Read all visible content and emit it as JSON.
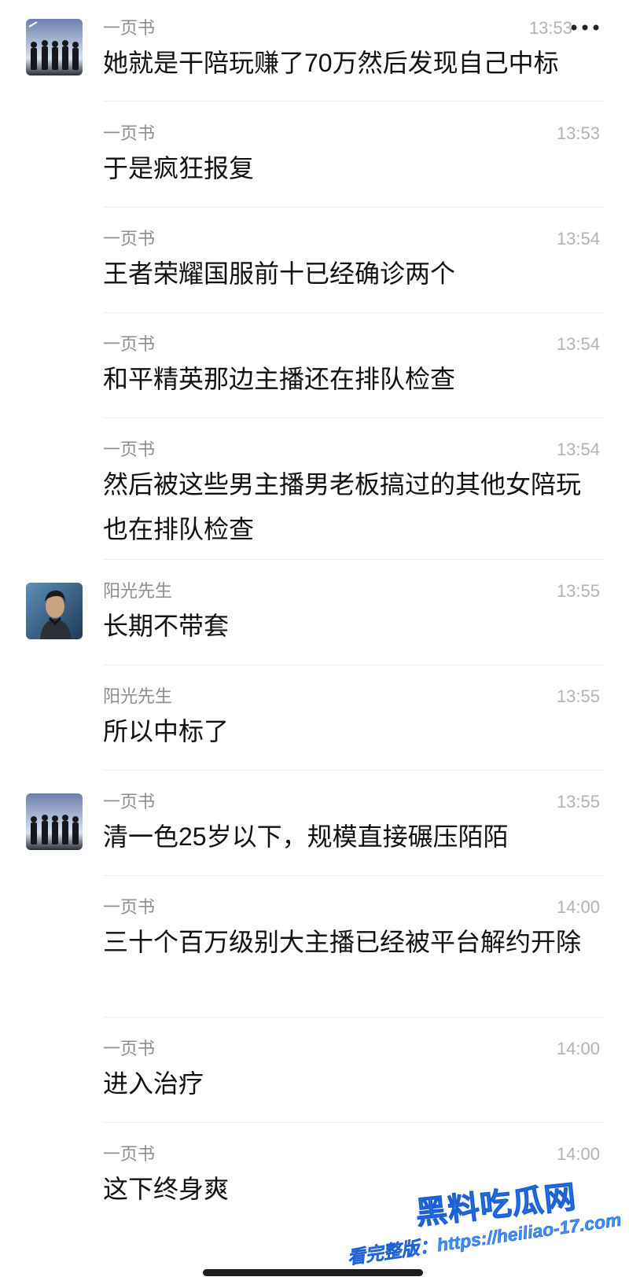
{
  "messages": [
    {
      "sender": "一页书",
      "time": "13:53",
      "text": "她就是干陪玩赚了70万然后发现自己中标",
      "avatar": "group-silhouette"
    },
    {
      "sender": "一页书",
      "time": "13:53",
      "text": "于是疯狂报复"
    },
    {
      "sender": "一页书",
      "time": "13:54",
      "text": "王者荣耀国服前十已经确诊两个"
    },
    {
      "sender": "一页书",
      "time": "13:54",
      "text": "和平精英那边主播还在排队检查"
    },
    {
      "sender": "一页书",
      "time": "13:54",
      "text": "然后被这些男主播男老板搞过的其他女陪玩也在排队检查"
    },
    {
      "sender": "阳光先生",
      "time": "13:55",
      "text": "长期不带套",
      "avatar": "man-portrait"
    },
    {
      "sender": "阳光先生",
      "time": "13:55",
      "text": "所以中标了"
    },
    {
      "sender": "一页书",
      "time": "13:55",
      "text": "清一色25岁以下，规模直接碾压陌陌",
      "avatar": "group-silhouette"
    },
    {
      "sender": "一页书",
      "time": "14:00",
      "text": "三十个百万级别大主播已经被平台解约开除"
    },
    {
      "sender": "一页书",
      "time": "14:00",
      "text": "进入治疗"
    },
    {
      "sender": "一页书",
      "time": "14:00",
      "text": "这下终身爽"
    }
  ],
  "header": {
    "more_icon": "more-dots-icon"
  },
  "watermark": {
    "title": "黑料吃瓜网",
    "url": "看完整版：https://heiliao-17.com"
  },
  "colors": {
    "background": "#ffffff",
    "sender": "#8e8e8e",
    "time": "#b3b3b3",
    "text": "#111111",
    "watermark": "#2f80ff"
  }
}
